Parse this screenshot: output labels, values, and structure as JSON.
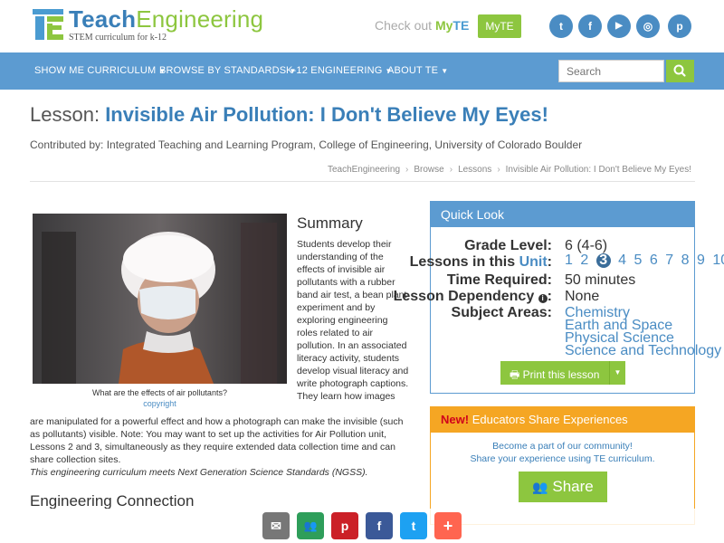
{
  "header": {
    "logo_word1": "Teach",
    "logo_word2": "Engineering",
    "tagline": "STEM curriculum for k-12",
    "checkout_text": "Check out",
    "checkout_my": "My",
    "checkout_te": "TE",
    "myte_button": "MyTE",
    "social": [
      {
        "name": "twitter-icon",
        "glyph": "t"
      },
      {
        "name": "facebook-icon",
        "glyph": "f"
      },
      {
        "name": "youtube-icon",
        "glyph": "▶"
      },
      {
        "name": "instagram-icon",
        "glyph": "◎"
      },
      {
        "name": "pinterest-icon",
        "glyph": "p"
      }
    ]
  },
  "nav": {
    "items": [
      "SHOW ME CURRICULUM",
      "BROWSE BY STANDARDS",
      "K-12 ENGINEERING",
      "ABOUT TE"
    ],
    "search_placeholder": "Search"
  },
  "lesson": {
    "prefix": "Lesson:",
    "title": "Invisible Air Pollution: I Don't Believe My Eyes!",
    "contributed": "Contributed by: Integrated Teaching and Learning Program, College of Engineering, University of Colorado Boulder"
  },
  "breadcrumb": [
    "TeachEngineering",
    "Browse",
    "Lessons",
    "Invisible Air Pollution: I Don't Believe My Eyes!"
  ],
  "photo": {
    "caption": "What are the effects of air pollutants?",
    "copyright": "copyright"
  },
  "summary": {
    "heading": "Summary",
    "wrapped": "Students develop their understanding of the effects of invisible air pollutants with a rubber band air test, a bean plant experiment and by exploring engineering roles related to air pollution. In an associated literacy activity, students develop visual literacy and write photograph captions. They learn how images",
    "full": "are manipulated for a powerful effect and how a photograph can make the invisible (such as pollutants) visible. Note: You may want to set up the activities for Air Pollution unit, Lessons 2 and 3, simultaneously as they require extended data collection time and can share collection sites.",
    "ngss": "This engineering curriculum meets Next Generation Science Standards (NGSS)."
  },
  "engineering_connection": "Engineering Connection",
  "quick_look": {
    "title": "Quick Look",
    "grade_label": "Grade Level:",
    "grade_value": "6 (4-6)",
    "lessons_label_pre": "Lessons in this",
    "lessons_label_unit": "Unit",
    "lessons_label_post": ":",
    "lessons": [
      "1",
      "2",
      "3",
      "4",
      "5",
      "6",
      "7",
      "8",
      "9",
      "10"
    ],
    "current_lesson": "3",
    "time_label": "Time Required:",
    "time_value": "50 minutes",
    "dependency_label": "Lesson Dependency",
    "dependency_value": "None",
    "subject_label": "Subject Areas:",
    "subjects": [
      "Chemistry",
      "Earth and Space",
      "Physical Science",
      "Science and Technology"
    ],
    "print_button": "Print this lesson"
  },
  "educators": {
    "new": "New!",
    "title": "Educators Share Experiences",
    "line1": "Become a part of our community!",
    "line2": "Share your experience using TE curriculum.",
    "share_button": "Share"
  },
  "share_bar": [
    {
      "name": "email-share-icon",
      "glyph": "✉",
      "color": "#777777"
    },
    {
      "name": "classroom-share-icon",
      "glyph": "👥",
      "color": "#2e9e5a"
    },
    {
      "name": "pinterest-share-icon",
      "glyph": "p",
      "color": "#cb2027"
    },
    {
      "name": "facebook-share-icon",
      "glyph": "f",
      "color": "#3b5998"
    },
    {
      "name": "twitter-share-icon",
      "glyph": "t",
      "color": "#1da1f2"
    },
    {
      "name": "more-share-icon",
      "glyph": "+",
      "color": "#ff6550"
    }
  ]
}
